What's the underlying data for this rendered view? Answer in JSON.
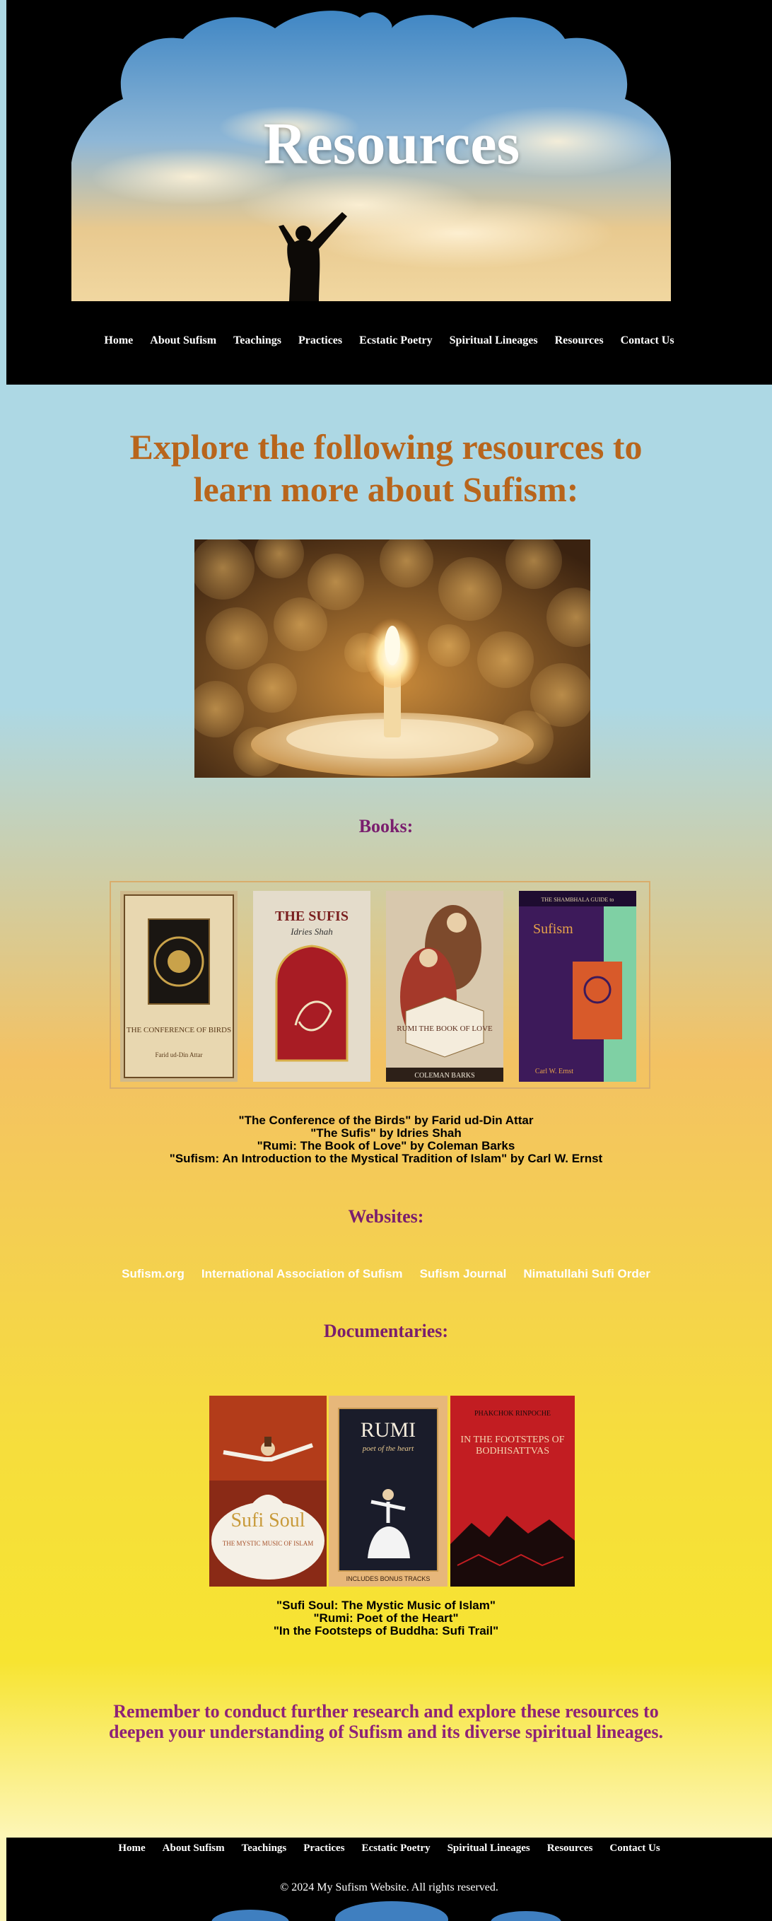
{
  "hero": {
    "title": "Resources"
  },
  "nav": [
    "Home",
    "About Sufism",
    "Teachings",
    "Practices",
    "Ecstatic Poetry",
    "Spiritual Lineages",
    "Resources",
    "Contact Us"
  ],
  "intro": {
    "line1": "Explore the following resources to",
    "line2": "learn more about Sufism:"
  },
  "books": {
    "heading": "Books:",
    "covers": [
      {
        "title": "THE CONFERENCE OF BIRDS",
        "author": "Farid ud-Din Attar"
      },
      {
        "title": "THE SUFIS",
        "author": "Idries Shah"
      },
      {
        "title": "RUMI THE BOOK OF LOVE",
        "author": "COLEMAN BARKS"
      },
      {
        "title": "Sufism",
        "author": "Carl W. Ernst",
        "series": "THE SHAMBHALA GUIDE to"
      }
    ],
    "list": [
      "\"The Conference of the Birds\" by Farid ud-Din Attar",
      "\"The Sufis\" by Idries Shah",
      "\"Rumi: The Book of Love\" by Coleman Barks",
      "\"Sufism: An Introduction to the Mystical Tradition of Islam\" by Carl W. Ernst"
    ]
  },
  "websites": {
    "heading": "Websites:",
    "links": [
      "Sufism.org",
      "International Association of Sufism",
      "Sufism Journal",
      "Nimatullahi Sufi Order"
    ]
  },
  "documentaries": {
    "heading": "Documentaries:",
    "covers": [
      {
        "title": "Sufi Soul",
        "subtitle": "THE MYSTIC MUSIC OF ISLAM"
      },
      {
        "title": "RUMI",
        "subtitle": "poet of the heart",
        "note": "INCLUDES BONUS TRACKS"
      },
      {
        "title": "IN THE FOOTSTEPS OF BODHISATTVAS",
        "author": "PHAKCHOK RINPOCHE"
      }
    ],
    "list": [
      "\"Sufi Soul: The Mystic Music of Islam\"",
      "\"Rumi: Poet of the Heart\"",
      "\"In the Footsteps of Buddha: Sufi Trail\""
    ]
  },
  "closing": {
    "line1": "Remember to conduct further research and explore these resources to",
    "line2": "deepen your understanding of Sufism and its diverse spiritual lineages."
  },
  "footer": {
    "nav": [
      "Home",
      "About Sufism",
      "Teachings",
      "Practices",
      "Ecstatic Poetry",
      "Spiritual Lineages",
      "Resources",
      "Contact Us"
    ],
    "copyright": "© 2024 My Sufism Website. All rights reserved."
  },
  "colors": {
    "heading_orange": "#b8651c",
    "heading_purple": "#7a1e6e",
    "nav_bg": "#000000"
  }
}
